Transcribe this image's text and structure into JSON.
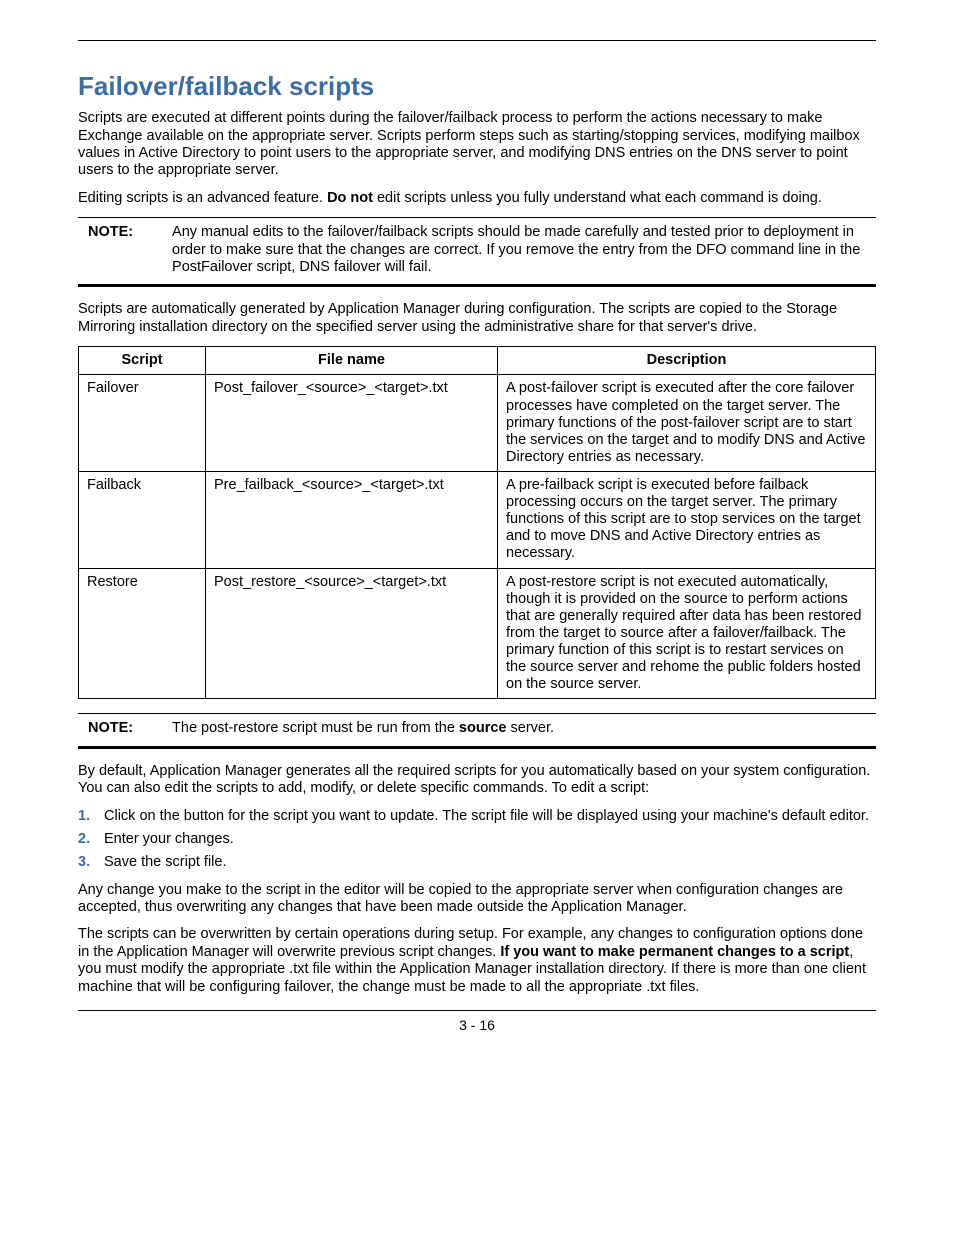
{
  "heading": "Failover/failback scripts",
  "para1": "Scripts are executed at different points during the failover/failback process to perform the actions necessary to make Exchange available on the appropriate server. Scripts perform steps such as starting/stopping services, modifying mailbox values in Active Directory to point users to the appropriate server, and modifying DNS entries on the DNS server to point users to the appropriate server.",
  "para2_a": "Editing scripts is an advanced feature. ",
  "para2_bold": "Do not",
  "para2_b": " edit scripts unless you fully understand what each command is doing.",
  "note1_label": "NOTE:",
  "note1_body_a": "Any manual edits to the failover/failback scripts should be made carefully and tested prior to deployment in order to make sure that the changes are correct. If you remove the ",
  "note1_body_code": "",
  "note1_body_b": " entry from the DFO command line in the PostFailover script, DNS failover will fail.",
  "para3": "Scripts are automatically generated by Application Manager during configuration. The scripts are copied to the Storage Mirroring installation directory on the specified server using the administrative share for that server's drive.",
  "table": {
    "headers": {
      "c1": "Script",
      "c2": "File name",
      "c3": "Description"
    },
    "rows": [
      {
        "script": "Failover",
        "file": "Post_failover_<source>_<target>.txt",
        "desc": "A post-failover script is executed after the core failover processes have completed on the target server. The primary functions of the post-failover script are to start the services on the target and to modify DNS and Active Directory entries as necessary."
      },
      {
        "script": "Failback",
        "file": "Pre_failback_<source>_<target>.txt",
        "desc": "A pre-failback script is executed before failback processing occurs on the target server. The primary functions of this script are to stop services on the target and to move DNS and Active Directory entries as necessary."
      },
      {
        "script": "Restore",
        "file": "Post_restore_<source>_<target>.txt",
        "desc": "A post-restore script is not executed automatically, though it is provided on the source to perform actions that are generally required after data has been restored from the target to source after a failover/failback. The primary function of this script is to restart services on the source server and rehome the public folders hosted on the source server."
      }
    ]
  },
  "note2_label": "NOTE:",
  "note2_a": "The post-restore script must be run from the ",
  "note2_bold": "source",
  "note2_b": " server.",
  "para4": "By default, Application Manager generates all the required scripts for you automatically based on your system configuration. You can also edit the scripts to add, modify, or delete specific commands. To edit a script:",
  "steps": [
    "Click on the button for the script you want to update. The script file will be displayed using your machine's default editor.",
    "Enter your changes.",
    "Save the script file."
  ],
  "para5": "Any change you make to the script in the editor will be copied to the appropriate server when configuration changes are accepted, thus overwriting any changes that have been made outside the Application Manager.",
  "para6_a": "The scripts can be overwritten by certain operations during setup. For example, any changes to configuration options done in the Application Manager will overwrite previous script changes. ",
  "para6_bold": "If you want to make permanent changes to a script",
  "para6_b": ", you must modify the appropriate .txt file within the Application Manager installation directory. If there is more than one client machine that will be configuring failover, the change must be made to all the appropriate .txt files.",
  "pagenum": "3 - 16"
}
